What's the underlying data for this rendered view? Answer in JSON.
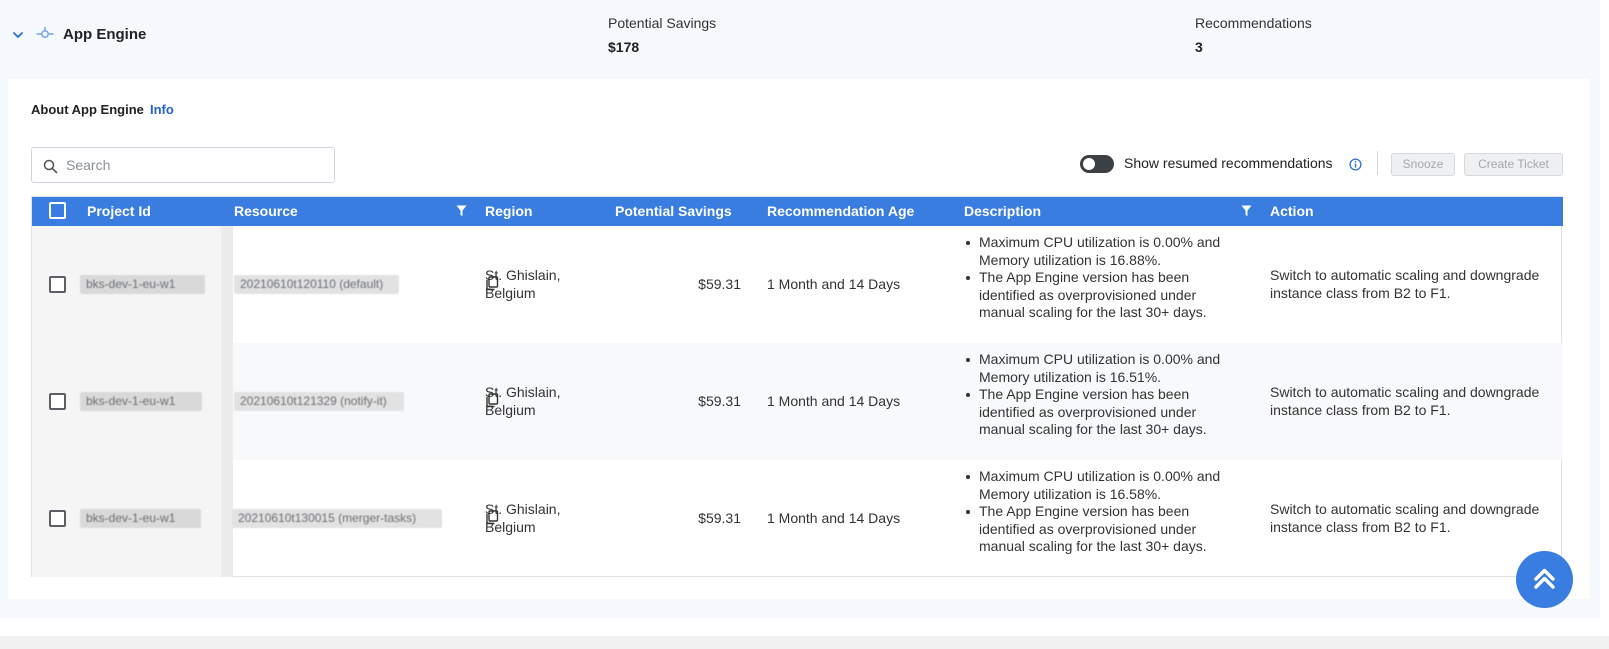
{
  "header": {
    "service_name": "App Engine",
    "potential_savings_label": "Potential Savings",
    "potential_savings_value": "$178",
    "recommendations_label": "Recommendations",
    "recommendations_value": "3"
  },
  "about": {
    "label": "About App Engine",
    "info_link": "Info"
  },
  "search": {
    "placeholder": "Search",
    "value": ""
  },
  "toolbar": {
    "toggle_label": "Show resumed recommendations",
    "toggle_on": false,
    "snooze_label": "Snooze",
    "create_ticket_label": "Create Ticket"
  },
  "table": {
    "columns": [
      "Project Id",
      "Resource",
      "Region",
      "Potential Savings",
      "Recommendation Age",
      "Description",
      "Action"
    ],
    "rows": [
      {
        "project_id": "bks-dev-1-eu-w1",
        "resource": "20210610t120110 (default)",
        "region": "St. Ghislain, Belgium",
        "potential_savings": "$59.31",
        "age": "1 Month and 14 Days",
        "desc_1": "Maximum CPU utilization is 0.00% and Memory utilization is 16.88%.",
        "desc_2": "The App Engine version has been identified as overprovisioned under manual scaling for the last 30+ days.",
        "action": "Switch to automatic scaling and downgrade instance class from B2 to F1."
      },
      {
        "project_id": "bks-dev-1-eu-w1",
        "resource": "20210610t121329 (notify-it)",
        "region": "St. Ghislain, Belgium",
        "potential_savings": "$59.31",
        "age": "1 Month and 14 Days",
        "desc_1": "Maximum CPU utilization is 0.00% and Memory utilization is 16.51%.",
        "desc_2": "The App Engine version has been identified as overprovisioned under manual scaling for the last 30+ days.",
        "action": "Switch to automatic scaling and downgrade instance class from B2 to F1."
      },
      {
        "project_id": "bks-dev-1-eu-w1",
        "resource": "20210610t130015 (merger-tasks)",
        "region": "St. Ghislain, Belgium",
        "potential_savings": "$59.31",
        "age": "1 Month and 14 Days",
        "desc_1": "Maximum CPU utilization is 0.00% and Memory utilization is 16.58%.",
        "desc_2": "The App Engine version has been identified as overprovisioned under manual scaling for the last 30+ days.",
        "action": "Switch to automatic scaling and downgrade instance class from B2 to F1."
      }
    ]
  },
  "colors": {
    "accent": "#3a7de0",
    "link": "#2563c9",
    "toggle_off": "#3c3f44"
  },
  "icons": [
    "chevron-down-icon",
    "app-engine-icon",
    "search-icon",
    "info-icon",
    "filter-icon",
    "copy-icon",
    "scroll-to-top-icon"
  ]
}
